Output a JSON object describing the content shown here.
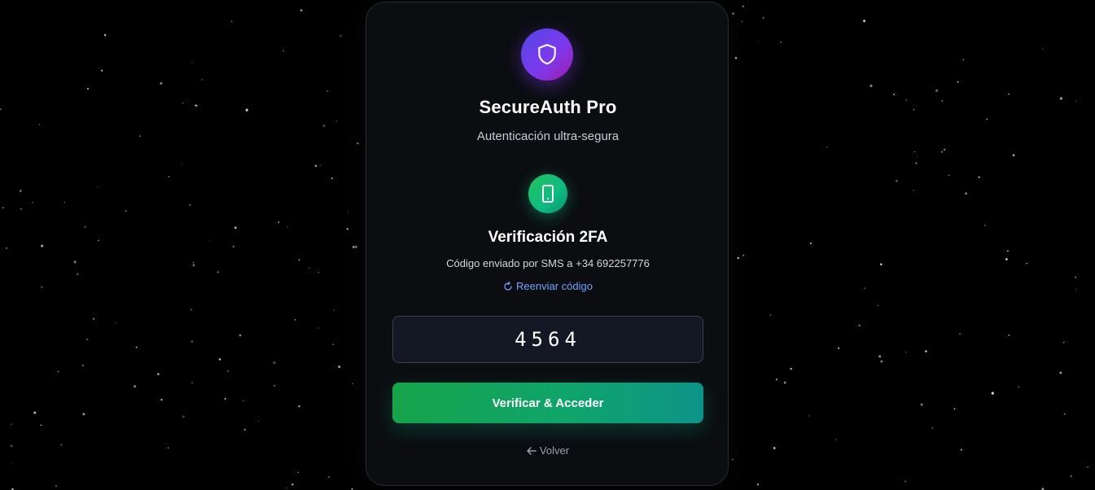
{
  "app": {
    "title": "SecureAuth Pro",
    "subtitle": "Autenticación ultra-segura",
    "logo_icon": "shield-icon"
  },
  "verification": {
    "icon": "smartphone-icon",
    "title": "Verificación 2FA",
    "sms_note": "Código enviado por SMS a +34 692257776",
    "resend_label": "Reenviar código",
    "resend_icon": "refresh-icon"
  },
  "code_field": {
    "value": "4564"
  },
  "actions": {
    "verify_label": "Verificar & Acceder",
    "back_label": "Volver",
    "back_icon": "arrow-left-icon"
  },
  "colors": {
    "background": "#000000",
    "card": "#0b0d11",
    "logo_gradient_start": "#4f46e5",
    "logo_gradient_end": "#a21caf",
    "success_gradient_start": "#16a34a",
    "success_gradient_end": "#0d9488",
    "link": "#6ea3ff"
  }
}
